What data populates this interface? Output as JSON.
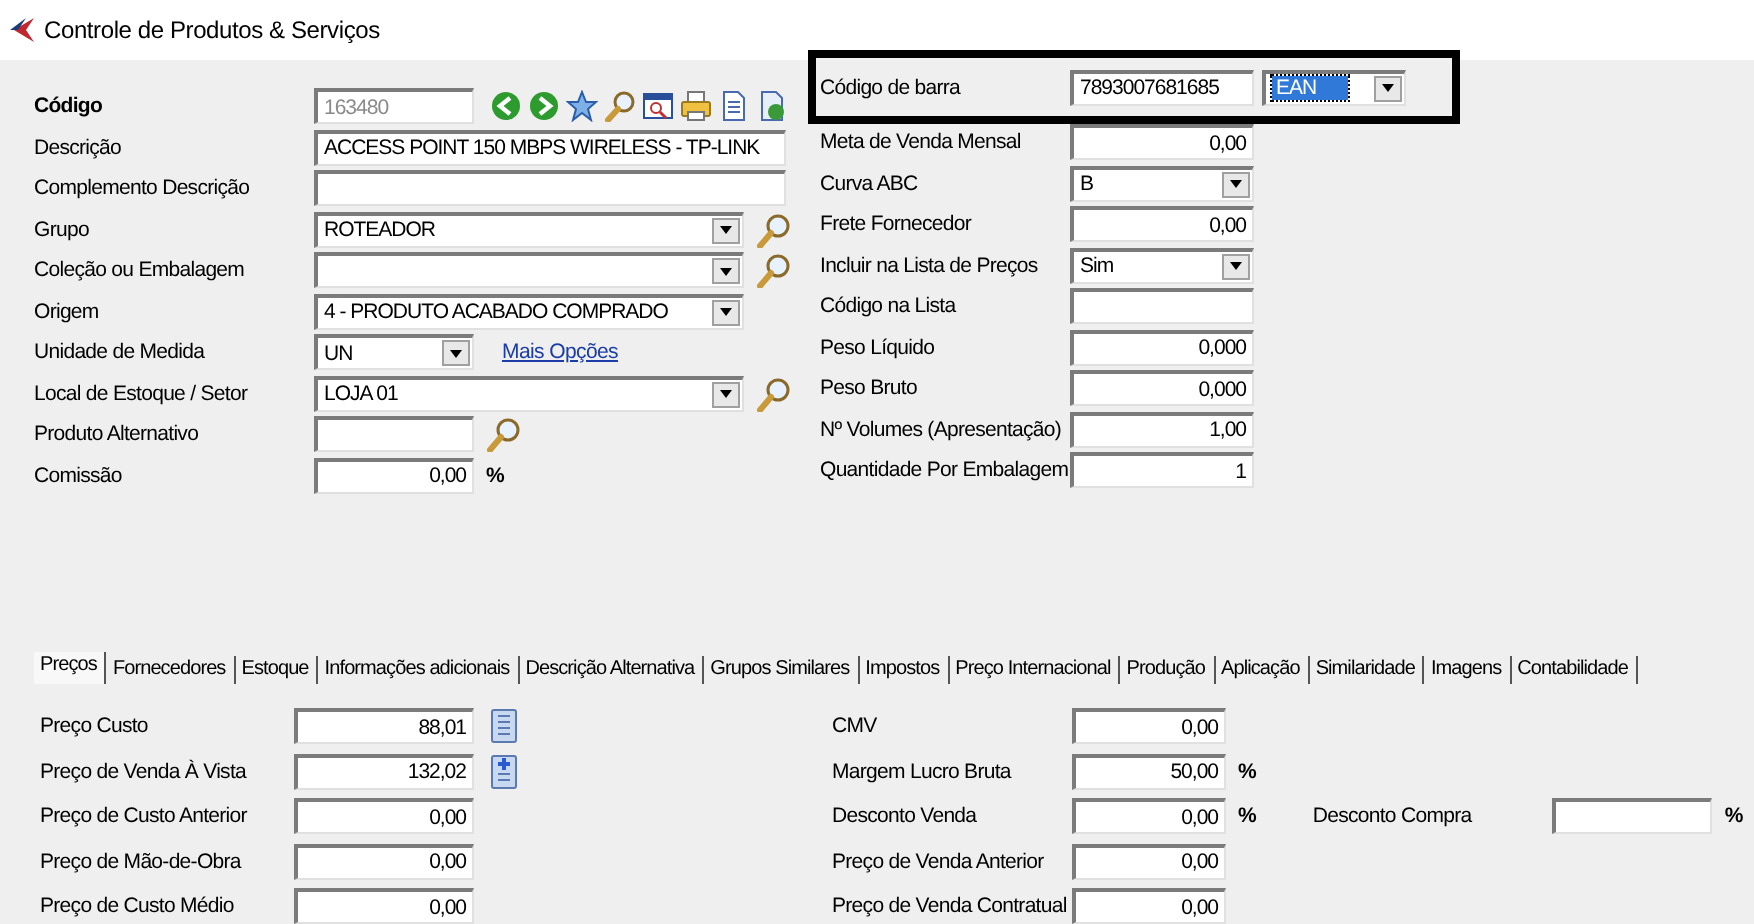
{
  "window": {
    "title": "Controle de Produtos & Serviços"
  },
  "left_fields": [
    {
      "label": "Código",
      "kind": "code",
      "value": "163480",
      "bold": true,
      "readonly": true
    },
    {
      "label": "Descrição",
      "kind": "text",
      "value": "ACCESS POINT 150 MBPS WIRELESS - TP-LINK"
    },
    {
      "label": "Complemento Descrição",
      "kind": "text"
    },
    {
      "label": "Grupo",
      "kind": "combo",
      "value": "ROTEADOR",
      "lookup": true
    },
    {
      "label": "Coleção ou Embalagem",
      "kind": "combo",
      "lookup": true
    },
    {
      "label": "Origem",
      "kind": "combo",
      "value": "4 - PRODUTO ACABADO COMPRADO"
    },
    {
      "label": "Unidade de Medida",
      "kind": "combo",
      "value": "UN",
      "link": "Mais Opções"
    },
    {
      "label": "Local de Estoque / Setor",
      "kind": "combo",
      "value": "LOJA 01",
      "lookup": true
    },
    {
      "label": "Produto Alternativo",
      "kind": "text",
      "lookup": true
    },
    {
      "label": "Comissão",
      "kind": "number",
      "value": "0,00",
      "suffix": "%"
    }
  ],
  "right_fields": [
    {
      "label": "Código de barra",
      "kind": "barcode",
      "value": "7893007681685",
      "type": "EAN",
      "type_focused": true,
      "highlighted": true
    },
    {
      "label": "Meta de Venda Mensal",
      "kind": "number",
      "value": "0,00"
    },
    {
      "label": "Curva ABC",
      "kind": "combo",
      "value": "B"
    },
    {
      "label": "Frete Fornecedor",
      "kind": "number",
      "value": "0,00"
    },
    {
      "label": "Incluir na Lista de Preços",
      "kind": "combo",
      "value": "Sim"
    },
    {
      "label": "Código na Lista",
      "kind": "text"
    },
    {
      "label": "Peso Líquido",
      "kind": "number",
      "value": "0,000"
    },
    {
      "label": "Peso Bruto",
      "kind": "number",
      "value": "0,000"
    },
    {
      "label": "Nº Volumes (Apresentação)",
      "kind": "number",
      "value": "1,00"
    },
    {
      "label": "Quantidade Por Embalagem",
      "kind": "number",
      "value": "1"
    }
  ],
  "tabs": [
    {
      "label": "Preços",
      "selected": true
    },
    {
      "label": "Fornecedores",
      "selected": false
    },
    {
      "label": "Estoque",
      "selected": false
    },
    {
      "label": "Informações adicionais",
      "selected": false
    },
    {
      "label": "Descrição Alternativa",
      "selected": false
    },
    {
      "label": "Grupos Similares",
      "selected": false
    },
    {
      "label": "Impostos",
      "selected": false
    },
    {
      "label": "Preço Internacional",
      "selected": false
    },
    {
      "label": "Produção",
      "selected": false
    },
    {
      "label": "Aplicação",
      "selected": false
    },
    {
      "label": "Similaridade",
      "selected": false
    },
    {
      "label": "Imagens",
      "selected": false
    },
    {
      "label": "Contabilidade",
      "selected": false
    }
  ],
  "prices_left": [
    {
      "label": "Preço Custo",
      "value": "88,01",
      "kind": "list"
    },
    {
      "label": "Preço de Venda À Vista",
      "value": "132,02",
      "kind": "add"
    },
    {
      "label": "Preço de Custo Anterior",
      "value": "0,00",
      "kind": "plain"
    },
    {
      "label": "Preço de Mão-de-Obra",
      "value": "0,00",
      "kind": "plain"
    },
    {
      "label": "Preço de Custo Médio",
      "value": "0,00",
      "kind": "plain"
    }
  ],
  "prices_right": [
    {
      "label": "CMV",
      "value": "0,00"
    },
    {
      "label": "Margem Lucro Bruta",
      "value": "50,00",
      "suffix": "%"
    },
    {
      "label": "Desconto Venda",
      "value": "0,00",
      "suffix": "%",
      "extra": {
        "label": "Desconto Compra",
        "suffix": "%"
      }
    },
    {
      "label": "Preço de Venda Anterior",
      "value": "0,00"
    },
    {
      "label": "Preço de Venda Contratual",
      "value": "0,00"
    }
  ]
}
